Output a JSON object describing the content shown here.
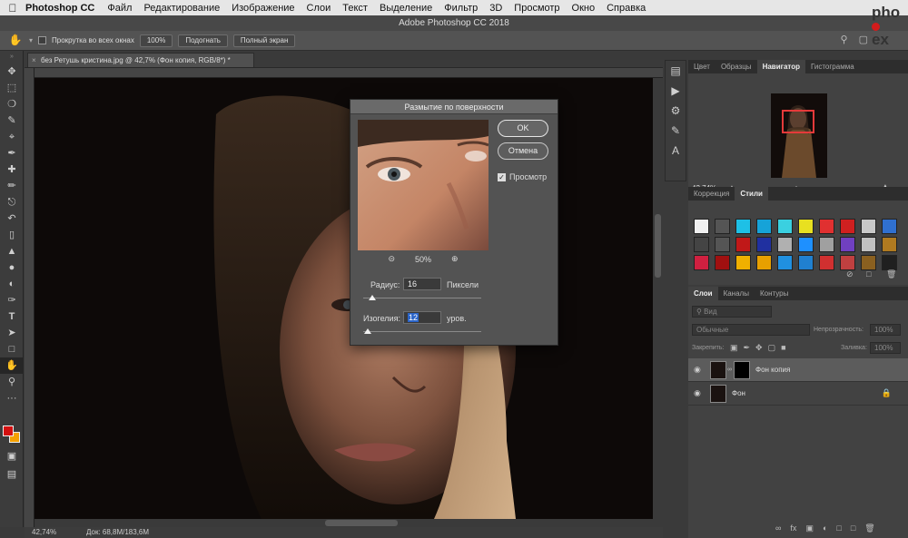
{
  "menubar": {
    "app": "Photoshop CC",
    "items": [
      "Файл",
      "Редактирование",
      "Изображение",
      "Слои",
      "Текст",
      "Выделение",
      "Фильтр",
      "3D",
      "Просмотр",
      "Окно",
      "Справка"
    ]
  },
  "window": {
    "title": "Adobe Photoshop CC 2018"
  },
  "options": {
    "scroll_all_label": "Прокрутка во всех окнах",
    "zoom_100": "100%",
    "fit": "Подогнать",
    "full_screen": "Полный экран"
  },
  "document": {
    "tab_title": "без Ретушь кристина.jpg @ 42,7% (Фон копия, RGB/8*) *",
    "zoom": "42,74%",
    "doc_size": "Док: 68,8M/183,6M"
  },
  "dialog": {
    "title": "Размытие по поверхности",
    "ok": "OK",
    "cancel": "Отмена",
    "preview_label": "Просмотр",
    "preview_zoom": "50%",
    "radius_label": "Радиус:",
    "radius_value": "16",
    "radius_unit": "Пиксели",
    "radius_fraction": 0.08,
    "threshold_label": "Изогелия:",
    "threshold_value": "12",
    "threshold_unit": "уров.",
    "threshold_fraction": 0.04
  },
  "panels": {
    "top_tabs": [
      "Цвет",
      "Образцы",
      "Навигатор",
      "Гистограмма"
    ],
    "active_top_tab": "Навигатор",
    "nav_zoom": "42,74%",
    "nav_zoom_fraction": 0.42,
    "mid_tabs": [
      "Коррекция",
      "Стили"
    ],
    "active_mid_tab": "Стили",
    "style_colors": [
      "#f0f0f0",
      "#555",
      "#1ec0e6",
      "#16a3d8",
      "#3ad0e0",
      "#e8e020",
      "#e03030",
      "#d02020",
      "#c8c8c8",
      "#3070d0",
      "#444",
      "#555",
      "#c01818",
      "#2030a0",
      "#b0b0b0",
      "#1e90ff",
      "#a0a0a0",
      "#7040c0",
      "#c0c0c0",
      "#b07a20",
      "#d02040",
      "#a01010",
      "#f0b000",
      "#e8a000",
      "#2090e0",
      "#2080d0",
      "#d03030",
      "#c04040",
      "#8a6020",
      "#202020"
    ],
    "layers_tabs": [
      "Слои",
      "Каналы",
      "Контуры"
    ],
    "active_layers_tab": "Слои",
    "filter_label": "Вид",
    "blend_mode": "Обычные",
    "opacity_label": "Непрозрачность:",
    "opacity_value": "100%",
    "lock_label": "Закрепить:",
    "fill_label": "Заливка:",
    "fill_value": "100%",
    "layers": [
      {
        "name": "Фон копия",
        "selected": true,
        "has_mask": true,
        "locked": false
      },
      {
        "name": "Фон",
        "selected": false,
        "has_mask": false,
        "locked": true
      }
    ]
  },
  "watermark": {
    "line1": "pho",
    "line2": "ex"
  }
}
